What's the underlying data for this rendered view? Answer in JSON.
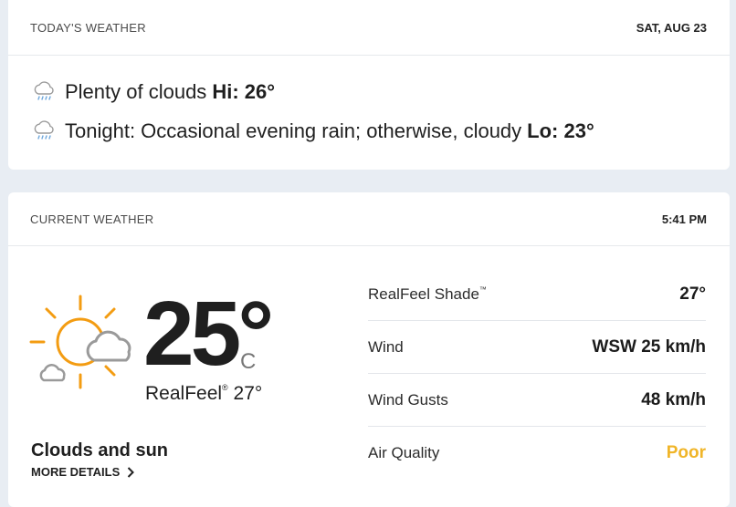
{
  "today": {
    "title": "TODAY'S WEATHER",
    "date": "SAT, AUG 23",
    "day_text": "Plenty of clouds",
    "day_temp": "Hi: 26°",
    "night_text": "Tonight: Occasional evening rain; otherwise, cloudy",
    "night_temp": "Lo: 23°",
    "icon": "rain-cloud-icon"
  },
  "current": {
    "title": "CURRENT WEATHER",
    "time": "5:41 PM",
    "temp": "25°",
    "unit": "C",
    "realfeel_label": "RealFeel",
    "realfeel_mark": "®",
    "realfeel_value": "27°",
    "phrase": "Clouds and sun",
    "more_details": "MORE DETAILS",
    "icon": "partly-sunny-icon",
    "details": [
      {
        "label": "RealFeel Shade",
        "mark": "™",
        "value": "27°"
      },
      {
        "label": "Wind",
        "mark": "",
        "value": "WSW 25 km/h"
      },
      {
        "label": "Wind Gusts",
        "mark": "",
        "value": "48 km/h"
      },
      {
        "label": "Air Quality",
        "mark": "",
        "value": "Poor"
      }
    ],
    "colors": {
      "sun": "#f39c12",
      "cloud": "#9a9a9a",
      "poor": "#f0b528"
    }
  }
}
